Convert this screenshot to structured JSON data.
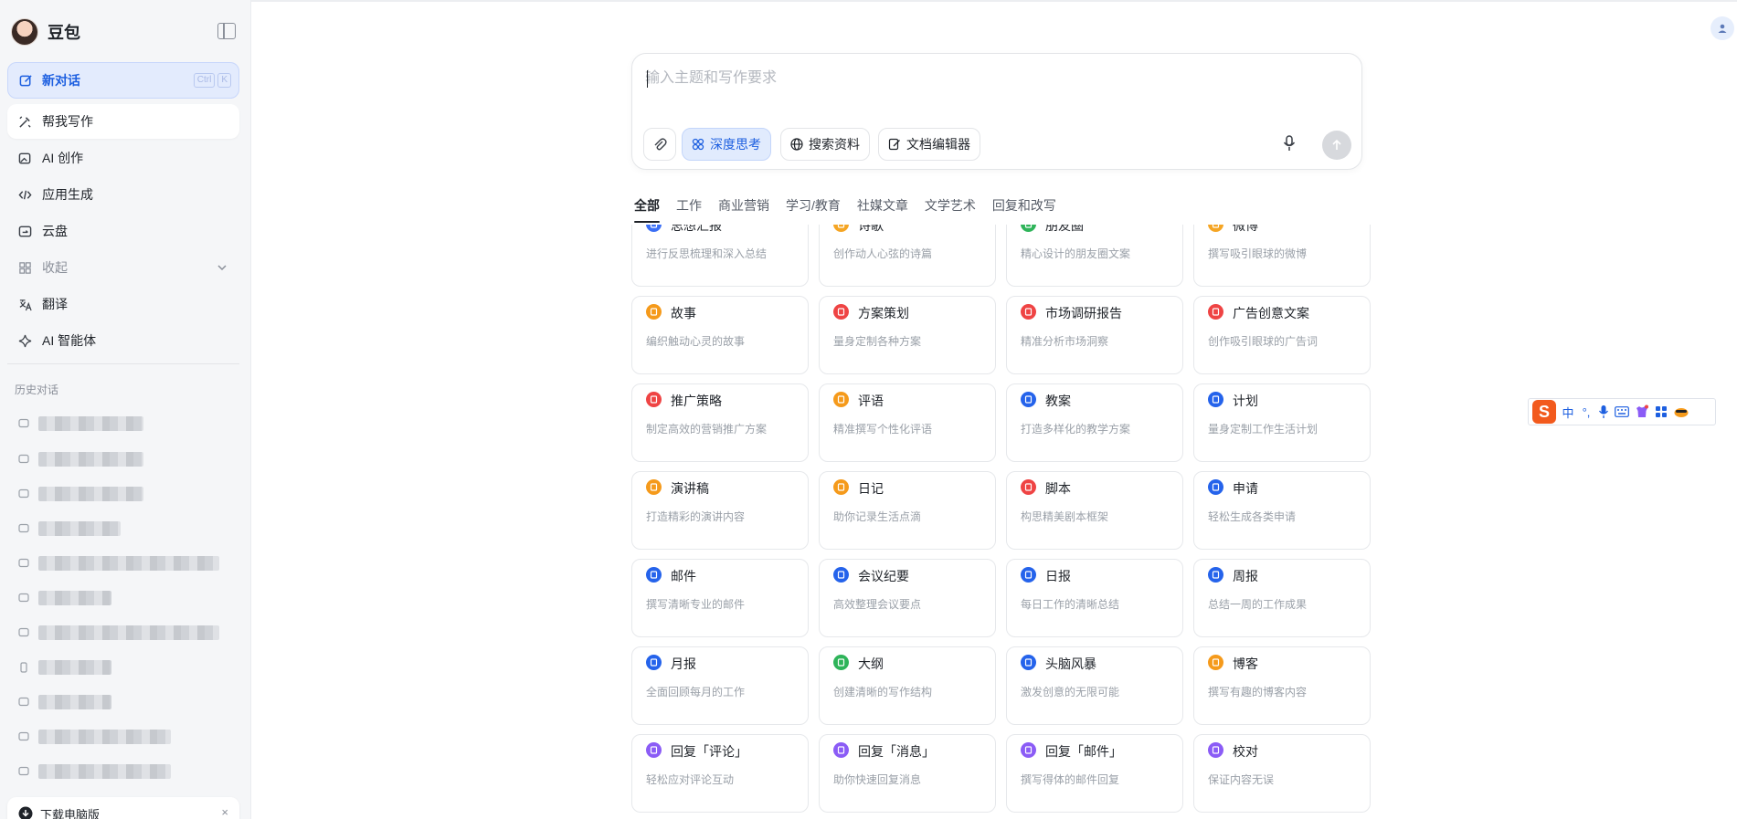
{
  "brand": {
    "name": "豆包"
  },
  "sidebar": {
    "new_chat": {
      "label": "新对话",
      "kbd": [
        "Ctrl",
        "K"
      ]
    },
    "items": [
      {
        "label": "帮我写作",
        "icon": "pen-icon",
        "active": true
      },
      {
        "label": "AI 创作",
        "icon": "image-create-icon"
      },
      {
        "label": "应用生成",
        "icon": "code-icon"
      },
      {
        "label": "云盘",
        "icon": "cloud-drive-icon"
      },
      {
        "label": "收起",
        "icon": "grid-icon",
        "muted": true
      },
      {
        "label": "翻译",
        "icon": "translate-icon"
      },
      {
        "label": "AI 智能体",
        "icon": "sparkle-icon"
      }
    ],
    "history_label": "历史对话",
    "history": [
      {
        "text": "████████████"
      },
      {
        "text": "████████████"
      },
      {
        "text": "████████████"
      },
      {
        "text": "██████████"
      },
      {
        "text": "████████████████████████"
      },
      {
        "text": "████████"
      },
      {
        "text": "████████████████████████"
      },
      {
        "text": "████████"
      },
      {
        "text": "████████"
      },
      {
        "text": "████████████████"
      },
      {
        "text": "████████████████"
      }
    ],
    "download": {
      "label": "下载电脑版",
      "close": "×"
    }
  },
  "composer": {
    "placeholder": "输入主题和写作要求",
    "tools": {
      "deep": "深度思考",
      "search": "搜索资料",
      "doc": "文档编辑器"
    }
  },
  "tabs": [
    "全部",
    "工作",
    "商业营销",
    "学习/教育",
    "社媒文章",
    "文学艺术",
    "回复和改写"
  ],
  "cards": [
    {
      "title": "思想汇报",
      "desc": "进行反思梳理和深入总结",
      "color": "#3b6ff5"
    },
    {
      "title": "诗歌",
      "desc": "创作动人心弦的诗篇",
      "color": "#f5a524"
    },
    {
      "title": "朋友圈",
      "desc": "精心设计的朋友圈文案",
      "color": "#2fb45a"
    },
    {
      "title": "微博",
      "desc": "撰写吸引眼球的微博",
      "color": "#f5a524"
    },
    {
      "title": "故事",
      "desc": "编织触动心灵的故事",
      "color": "#f59a1b"
    },
    {
      "title": "方案策划",
      "desc": "量身定制各种方案",
      "color": "#ef4444"
    },
    {
      "title": "市场调研报告",
      "desc": "精准分析市场洞察",
      "color": "#ef4444"
    },
    {
      "title": "广告创意文案",
      "desc": "创作吸引眼球的广告词",
      "color": "#ef4444"
    },
    {
      "title": "推广策略",
      "desc": "制定高效的营销推广方案",
      "color": "#ef4444"
    },
    {
      "title": "评语",
      "desc": "精准撰写个性化评语",
      "color": "#f59a1b"
    },
    {
      "title": "教案",
      "desc": "打造多样化的教学方案",
      "color": "#2563eb"
    },
    {
      "title": "计划",
      "desc": "量身定制工作生活计划",
      "color": "#2563eb"
    },
    {
      "title": "演讲稿",
      "desc": "打造精彩的演讲内容",
      "color": "#f59a1b"
    },
    {
      "title": "日记",
      "desc": "助你记录生活点滴",
      "color": "#f59a1b"
    },
    {
      "title": "脚本",
      "desc": "构思精美剧本框架",
      "color": "#ef4444"
    },
    {
      "title": "申请",
      "desc": "轻松生成各类申请",
      "color": "#2563eb"
    },
    {
      "title": "邮件",
      "desc": "撰写清晰专业的邮件",
      "color": "#2563eb"
    },
    {
      "title": "会议纪要",
      "desc": "高效整理会议要点",
      "color": "#2563eb"
    },
    {
      "title": "日报",
      "desc": "每日工作的清晰总结",
      "color": "#2563eb"
    },
    {
      "title": "周报",
      "desc": "总结一周的工作成果",
      "color": "#2563eb"
    },
    {
      "title": "月报",
      "desc": "全面回顾每月的工作",
      "color": "#2563eb"
    },
    {
      "title": "大纲",
      "desc": "创建清晰的写作结构",
      "color": "#2fb45a"
    },
    {
      "title": "头脑风暴",
      "desc": "激发创意的无限可能",
      "color": "#2563eb"
    },
    {
      "title": "博客",
      "desc": "撰写有趣的博客内容",
      "color": "#f59a1b"
    },
    {
      "title": "回复「评论」",
      "desc": "轻松应对评论互动",
      "color": "#8b5cf6"
    },
    {
      "title": "回复「消息」",
      "desc": "助你快速回复消息",
      "color": "#8b5cf6"
    },
    {
      "title": "回复「邮件」",
      "desc": "撰写得体的邮件回复",
      "color": "#8b5cf6"
    },
    {
      "title": "校对",
      "desc": "保证内容无误",
      "color": "#8b5cf6"
    }
  ],
  "ime": {
    "logo": "S",
    "mode": "中",
    "punct": "°,"
  }
}
